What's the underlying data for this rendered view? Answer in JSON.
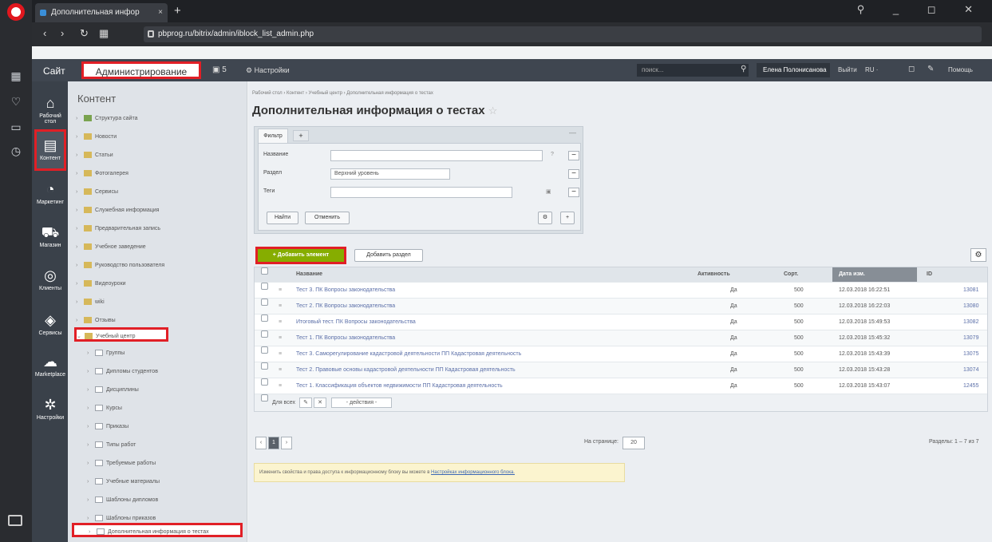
{
  "browser": {
    "tab_title": "Дополнительная инфор",
    "tab_close": "×",
    "new_tab": "+",
    "url": "pbprog.ru/bitrix/admin/iblock_list_admin.php",
    "controls": "⚲ _ ◻ ✕"
  },
  "panel": {
    "site": "Сайт",
    "admin": "Администрирование",
    "updates": "▣ 5",
    "settings": "⚙ Настройки",
    "search_placeholder": "поиск...",
    "user": "Елена Полонисанова",
    "logout": "Выйти",
    "lang": "RU ·",
    "help": "Помощь"
  },
  "admin_menu": [
    {
      "icon": "⌂",
      "label": "Рабочий стол"
    },
    {
      "icon": "▤",
      "label": "Контент"
    },
    {
      "icon": "◔",
      "label": "Маркетинг"
    },
    {
      "icon": "⛟",
      "label": "Магазин"
    },
    {
      "icon": "◎",
      "label": "Клиенты"
    },
    {
      "icon": "◈",
      "label": "Сервисы"
    },
    {
      "icon": "☁",
      "label": "Marketplace"
    },
    {
      "icon": "✲",
      "label": "Настройки"
    }
  ],
  "tree": {
    "title": "Контент",
    "items": [
      "Структура сайта",
      "Новости",
      "Статьи",
      "Фотогалерея",
      "Сервисы",
      "Служебная информация",
      "Предварительная запись",
      "Учебное заведение",
      "Руководство пользователя",
      "Видеоуроки",
      "wiki",
      "Отзывы",
      "Учебный центр"
    ],
    "subitems": [
      "Группы",
      "Дипломы студентов",
      "Дисциплины",
      "Курсы",
      "Приказы",
      "Типы работ",
      "Требуемые работы",
      "Учебные материалы",
      "Шаблоны дипломов",
      "Шаблоны приказов",
      "Дополнительная информация о тестах"
    ]
  },
  "main": {
    "breadcrumb": "Рабочий стол  ›  Контент  ›  Учебный центр  ›  Дополнительная информация о тестах",
    "title": "Дополнительная информация о тестах",
    "star": "☆",
    "filter": {
      "tab": "Фильтр",
      "tab_add": "+",
      "min": "—",
      "name_label": "Название",
      "section_label": "Раздел",
      "section_value": "Верхний уровень",
      "tags_label": "Теги",
      "q": "?",
      "find": "Найти",
      "cancel": "Отменить"
    },
    "add_element": "+ Добавить элемент",
    "add_section": "Добавить раздел",
    "columns": {
      "name": "Название",
      "active": "Активность",
      "sort": "Сорт.",
      "date": "Дата изм.",
      "id": "ID"
    },
    "rows": [
      {
        "name": "Тест 3. ПК Вопросы законодательства",
        "active": "Да",
        "sort": "500",
        "date": "12.03.2018 16:22:51",
        "id": "13081"
      },
      {
        "name": "Тест 2. ПК Вопросы законодательства",
        "active": "Да",
        "sort": "500",
        "date": "12.03.2018 16:22:03",
        "id": "13080"
      },
      {
        "name": "Итоговый тест. ПК Вопросы законодательства",
        "active": "Да",
        "sort": "500",
        "date": "12.03.2018 15:49:53",
        "id": "13082"
      },
      {
        "name": "Тест 1. ПК Вопросы законодательства",
        "active": "Да",
        "sort": "500",
        "date": "12.03.2018 15:45:32",
        "id": "13079"
      },
      {
        "name": "Тест 3. Саморегулирование кадастровой деятельности ПП Кадастровая деятельность",
        "active": "Да",
        "sort": "500",
        "date": "12.03.2018 15:43:39",
        "id": "13075"
      },
      {
        "name": "Тест 2. Правовые основы кадастровой деятельности ПП Кадастровая деятельность",
        "active": "Да",
        "sort": "500",
        "date": "12.03.2018 15:43:28",
        "id": "13074"
      },
      {
        "name": "Тест 1. Классификация объектов недвижимости ПП Кадастровая деятельность",
        "active": "Да",
        "sort": "500",
        "date": "12.03.2018 15:43:07",
        "id": "12455"
      }
    ],
    "for_all": "Для всех",
    "actions": "- действия -",
    "per_page_label": "На странице:",
    "per_page": "20",
    "records": "Разделы: 1 – 7 из 7",
    "page": "1",
    "notice_text": "Изменить свойства и права доступа к информационному блоку вы можете в ",
    "notice_link": "Настройках информационного блока."
  }
}
